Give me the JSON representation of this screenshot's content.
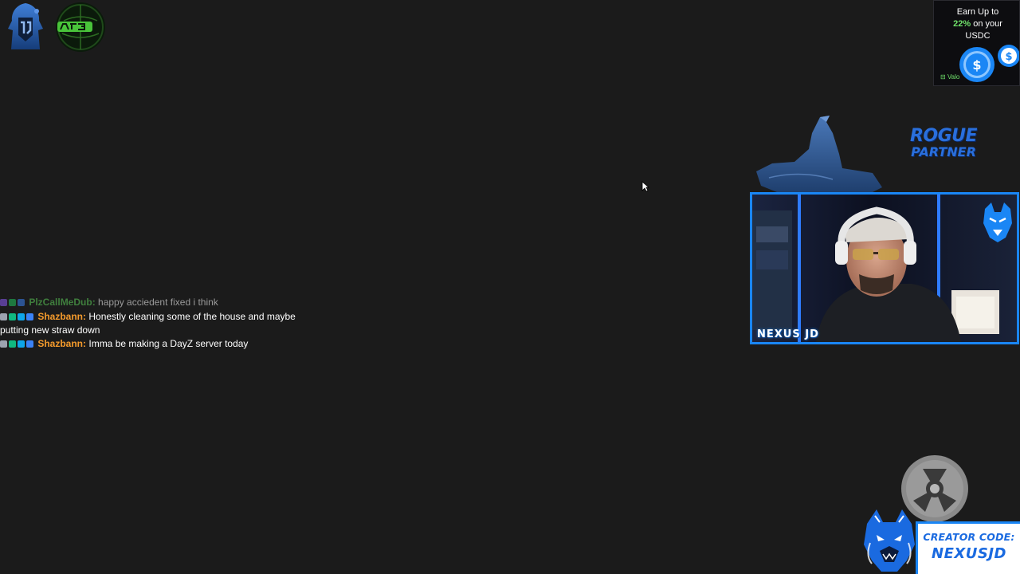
{
  "chat": {
    "messages": [
      {
        "user": "PlzCallMeDub",
        "separator": ":",
        "text": "happy acciedent fixed i think",
        "user_color": "#5ed15a",
        "faded": true
      },
      {
        "user": "Shazbann",
        "separator": ":",
        "text": "Honestly cleaning some of the house and maybe putting new straw down",
        "user_color": "#f59b2c",
        "faded": false
      },
      {
        "user": "Shazbann",
        "separator": ":",
        "text": "Imma be making a DayZ server today",
        "user_color": "#f59b2c",
        "faded": false
      }
    ]
  },
  "promo": {
    "line1": "Earn Up to",
    "percent": "22%",
    "line2_suffix": " on your",
    "line3": "USDC",
    "brand": "Valo",
    "accent": "#6fe16a"
  },
  "rogue": {
    "line1": "ROGUE",
    "line2": "PARTNER",
    "color": "#2a6fdc"
  },
  "cam": {
    "name": "NEXUS JD",
    "border_color": "#1a86f5"
  },
  "creator": {
    "label": "CREATOR CODE:",
    "value": "NEXUSJD"
  },
  "icons": {
    "logo_left": "hooded-figure-logo-icon",
    "logo_right": "green-globe-logo-icon",
    "reel": "film-reel-icon",
    "cursor": "mouse-cursor-icon",
    "wolf": "howling-wolf-icon",
    "wolf_mascot": "wolf-mascot-icon",
    "coin": "usdc-coin-icon"
  }
}
